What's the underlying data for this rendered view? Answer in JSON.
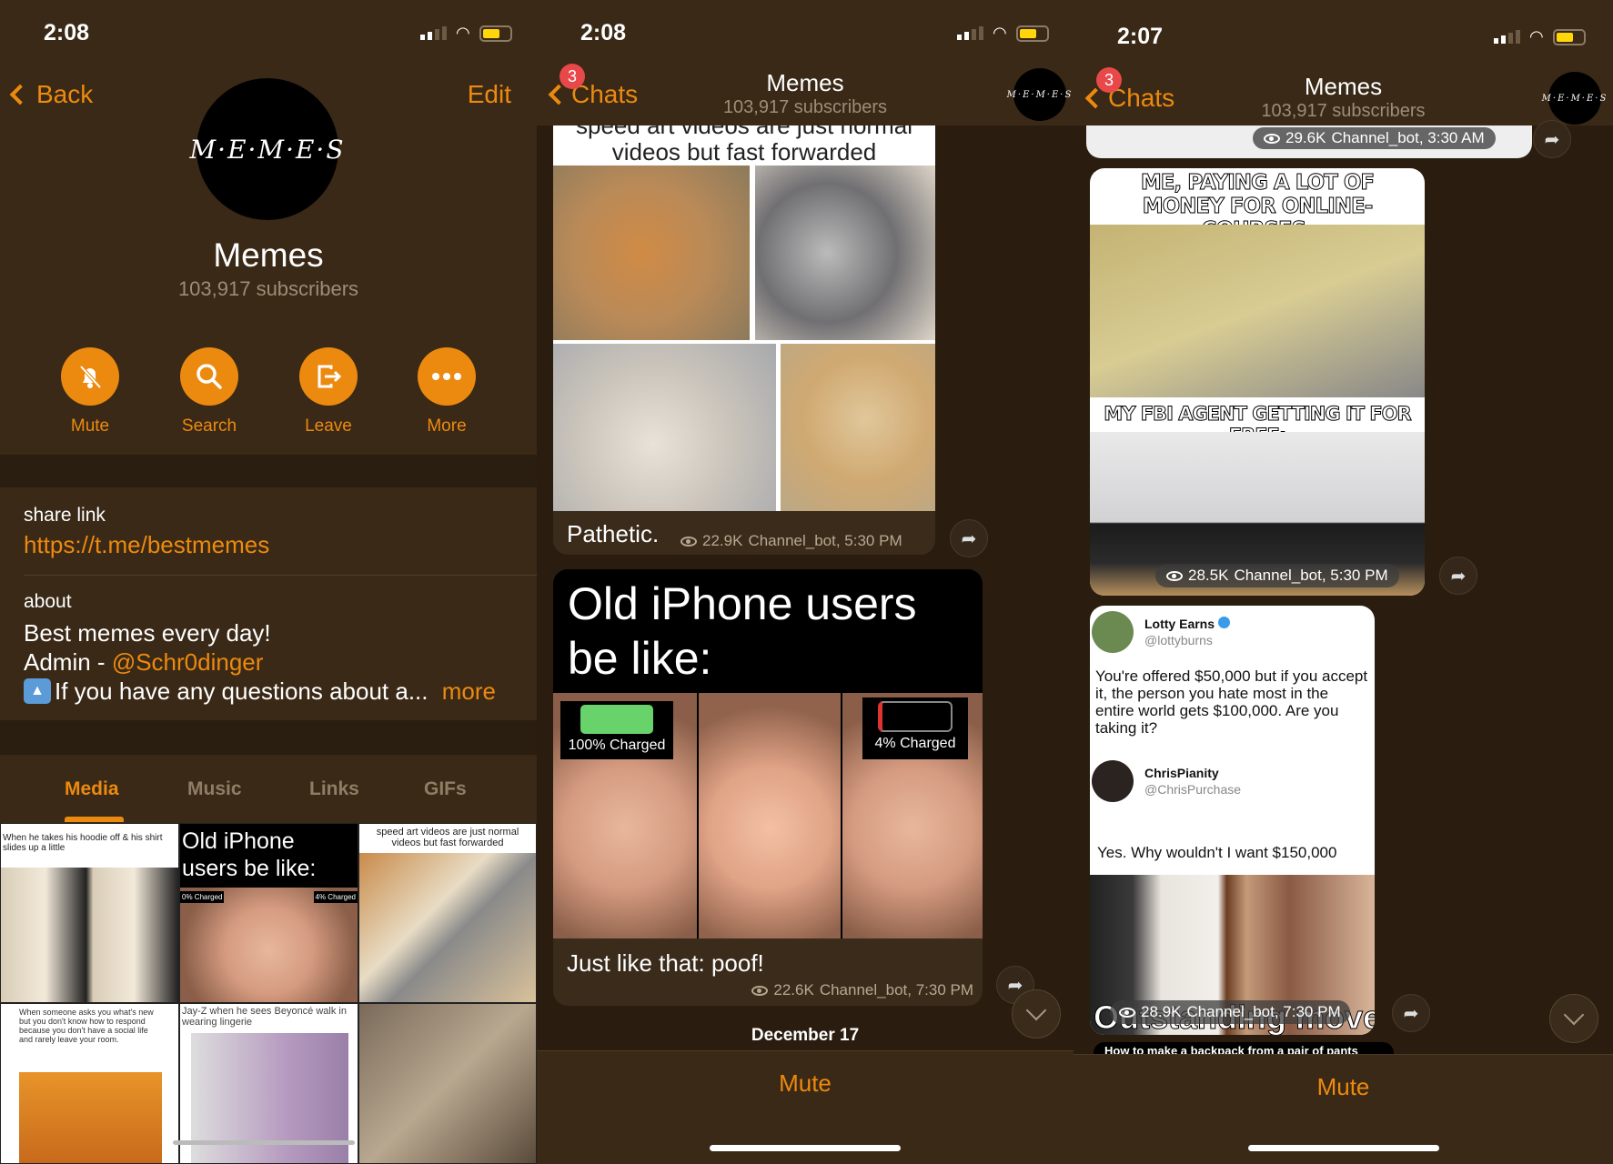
{
  "accent": "#ec8a10",
  "profile": {
    "status_time": "2:08",
    "back_label": "Back",
    "edit_label": "Edit",
    "avatar_text": "M·E·M·E·S",
    "title": "Memes",
    "subscribers": "103,917 subscribers",
    "actions": [
      {
        "label": "Mute",
        "icon": "bell-slash-icon"
      },
      {
        "label": "Search",
        "icon": "search-icon"
      },
      {
        "label": "Leave",
        "icon": "leave-icon"
      },
      {
        "label": "More",
        "icon": "more-icon"
      }
    ],
    "share_link_label": "share link",
    "share_link": "https://t.me/bestmemes",
    "about_label": "about",
    "about_line1": "Best memes every day!",
    "about_admin_prefix": "Admin - ",
    "about_admin_handle": "@Schr0dinger",
    "about_line3": "If you have any questions about a...",
    "more_label": "more",
    "tabs": [
      {
        "label": "Media",
        "active": true
      },
      {
        "label": "Music"
      },
      {
        "label": "Links"
      },
      {
        "label": "GIFs"
      }
    ],
    "media": [
      {
        "caption": "When he takes his hoodie off & his shirt slides up a little"
      },
      {
        "caption": "Old iPhone users be like:",
        "left": "0% Charged",
        "right": "4% Charged"
      },
      {
        "caption": "speed art videos are just normal videos but fast forwarded"
      },
      {
        "caption": "When someone asks you what's new but you don't know how to respond because you don't have a social life and rarely leave your room."
      },
      {
        "caption": "Jay-Z when he sees Beyoncé walk in wearing lingerie"
      },
      {
        "caption": ""
      }
    ]
  },
  "chat1": {
    "status_time": "2:08",
    "back_label": "Chats",
    "badge": "3",
    "title": "Memes",
    "subscribers": "103,917 subscribers",
    "avatar_text": "M·E·M·E·S",
    "msg1": {
      "image_text_top": "speed art videos are just normal",
      "image_text": "videos but fast forwarded",
      "caption": "Pathetic.",
      "views": "22.9K",
      "author_time": "Channel_bot, 5:30 PM"
    },
    "msg2": {
      "image_title": "Old iPhone users be like:",
      "battery_full": "100% Charged",
      "battery_low": "4% Charged",
      "caption": "Just like that: poof!",
      "views": "22.6K",
      "author_time": "Channel_bot, 7:30 PM"
    },
    "date_separator": "December 17",
    "mute_label": "Mute"
  },
  "chat2": {
    "status_time": "2:07",
    "back_label": "Chats",
    "badge": "3",
    "title": "Memes",
    "subscribers": "103,917 subscribers",
    "avatar_text": "M·E·M·E·S",
    "msg0": {
      "views": "29.6K",
      "author_time": "Channel_bot, 3:30 AM"
    },
    "msg1": {
      "text_top": "ME, PAYING A LOT OF MONEY FOR ONLINE-COURSES:",
      "text_bottom": "MY FBI AGENT GETTING IT FOR FREE:",
      "views": "28.5K",
      "author_time": "Channel_bot, 5:30 PM"
    },
    "msg2": {
      "user1_name": "Lotty Earns",
      "user1_handle": "@lottyburns",
      "tweet": "You're offered $50,000 but if you accept it, the person you hate most in the entire world gets $100,000. Are you taking it?",
      "user2_name": "ChrisPianity",
      "user2_handle": "@ChrisPurchase",
      "reply": "Yes. Why wouldn't I want $150,000",
      "video_text": "Outstanding move",
      "views": "28.9K",
      "author_time": "Channel_bot, 7:30 PM"
    },
    "next_preview": "How to make a backpack from a pair of pants",
    "mute_label": "Mute"
  }
}
